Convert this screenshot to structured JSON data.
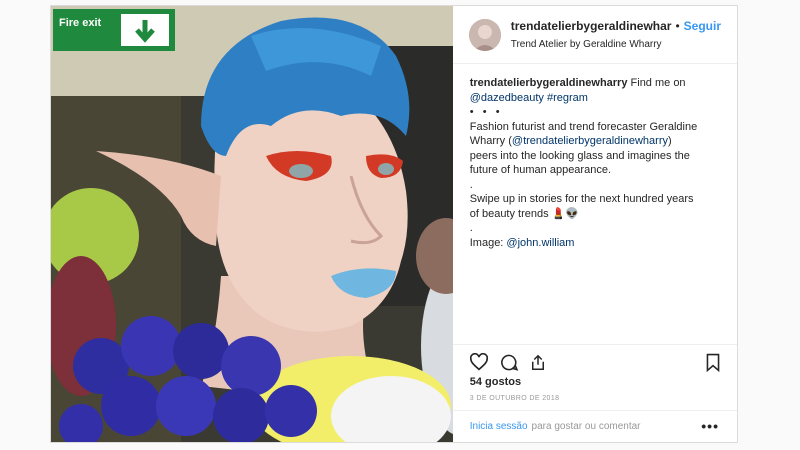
{
  "post": {
    "username": "trendatelierbygeraldinewhar",
    "dot": "•",
    "follow_label": "Seguir",
    "full_name": "Trend Atelier by Geraldine Wharry",
    "caption": {
      "author": "trendatelierbygeraldinewharry",
      "line1_rest": " Find me on",
      "mention_dazed": "@dazedbeauty",
      "hashtag": "#regram",
      "dots": "•   •   •",
      "body1": "Fashion futurist and trend forecaster Geraldine",
      "body2_pre": "Wharry (",
      "mention_self": "@trendatelierbygeraldinewharry",
      "body2_post": ")",
      "body3": "peers into the looking glass and imagines the",
      "body4": "future of human appearance.",
      "sep1": ".",
      "body5": "Swipe up in stories for the next hundred years",
      "body6": "of beauty trends 💄👽",
      "sep2": ".",
      "image_label": "Image: ",
      "mention_photographer": "@john.william"
    },
    "likes": "54 gostos",
    "date": "3 DE OUTUBRO DE 2018",
    "login_label": "Inicia sessão",
    "comment_hint": "para gostar ou comentar",
    "more_label": "•••"
  },
  "photo": {
    "exit_sign_text": "Fire exit",
    "hair_color": "#2f7fc4",
    "lips_color": "#6fb6e0",
    "eye_shadow_color": "#d33a26",
    "sign_color": "#1f8a3d"
  },
  "icons": {
    "heart": "heart-icon",
    "comment": "comment-icon",
    "share": "share-icon",
    "bookmark": "bookmark-icon"
  }
}
